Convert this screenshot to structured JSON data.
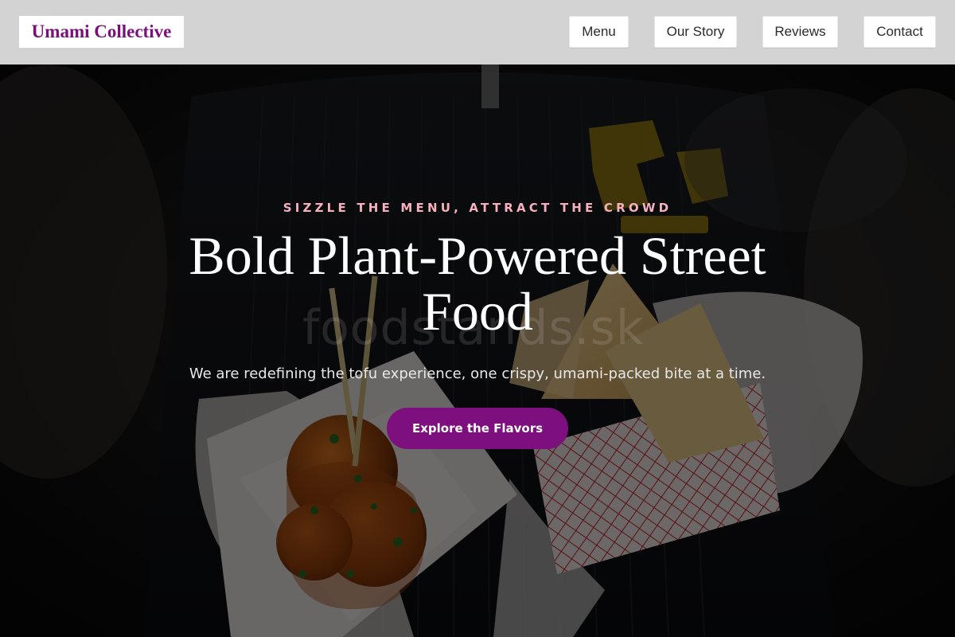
{
  "header": {
    "brand": "Umami Collective",
    "nav": [
      {
        "label": "Menu"
      },
      {
        "label": "Our Story"
      },
      {
        "label": "Reviews"
      },
      {
        "label": "Contact"
      }
    ]
  },
  "hero": {
    "tagline": "SIZZLE THE MENU, ATTRACT THE CROWD",
    "headline": "Bold Plant-Powered Street Food",
    "subtext": "We are redefining the tofu experience, one crispy, umami-packed bite at a time.",
    "cta_label": "Explore the Flavors",
    "watermark": "foodstands.sk"
  },
  "colors": {
    "brand": "#7a0f7a",
    "accent": "#7e0f7e",
    "tagline": "#f7b0bd",
    "header_bg": "#d3d3d4"
  }
}
